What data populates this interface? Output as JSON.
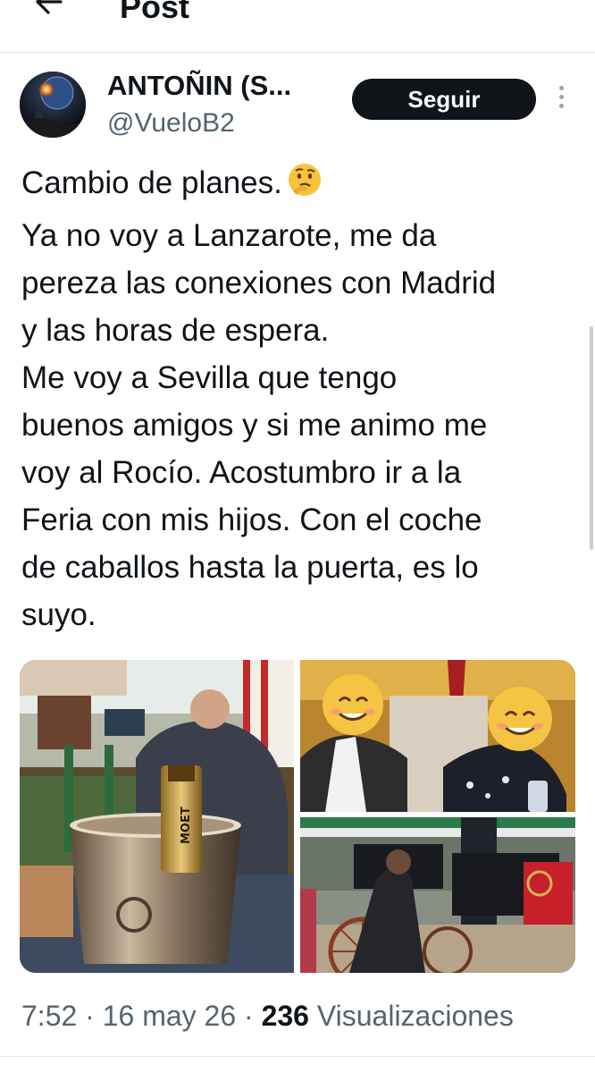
{
  "header": {
    "title": "Post",
    "back_icon": "arrow-left-icon"
  },
  "author": {
    "display_name": "ANTOÑIN (S...",
    "handle": "@VueloB2",
    "follow_label": "Seguir",
    "more_icon": "more-vertical-icon"
  },
  "post": {
    "lines": [
      "Cambio de planes.",
      "Ya no voy a Lanzarote, me da",
      "pereza las conexiones con Madrid",
      "y las horas de espera.",
      "Me voy a Sevilla que tengo",
      "buenos amigos y si me animo me",
      "voy al Rocío. Acostumbro ir a la",
      "Feria con mis hijos. Con el coche",
      "de caballos hasta la puerta, es lo",
      "suyo."
    ],
    "emoji": "thinking-face-emoji",
    "media": {
      "left": {
        "label_text": "MOET"
      },
      "top_right": {
        "stickers": [
          "smiling-face-emoji",
          "smiling-face-emoji"
        ]
      },
      "bottom_right": {}
    }
  },
  "meta": {
    "time": "7:52",
    "sep1": " · ",
    "date": "16 may 26",
    "sep2": " · ",
    "views_count": "236",
    "views_label": " Visualizaciones"
  },
  "colors": {
    "text": "#0f1419",
    "secondary": "#536471",
    "button_bg": "#0f1419",
    "border": "#e6e9ec"
  }
}
